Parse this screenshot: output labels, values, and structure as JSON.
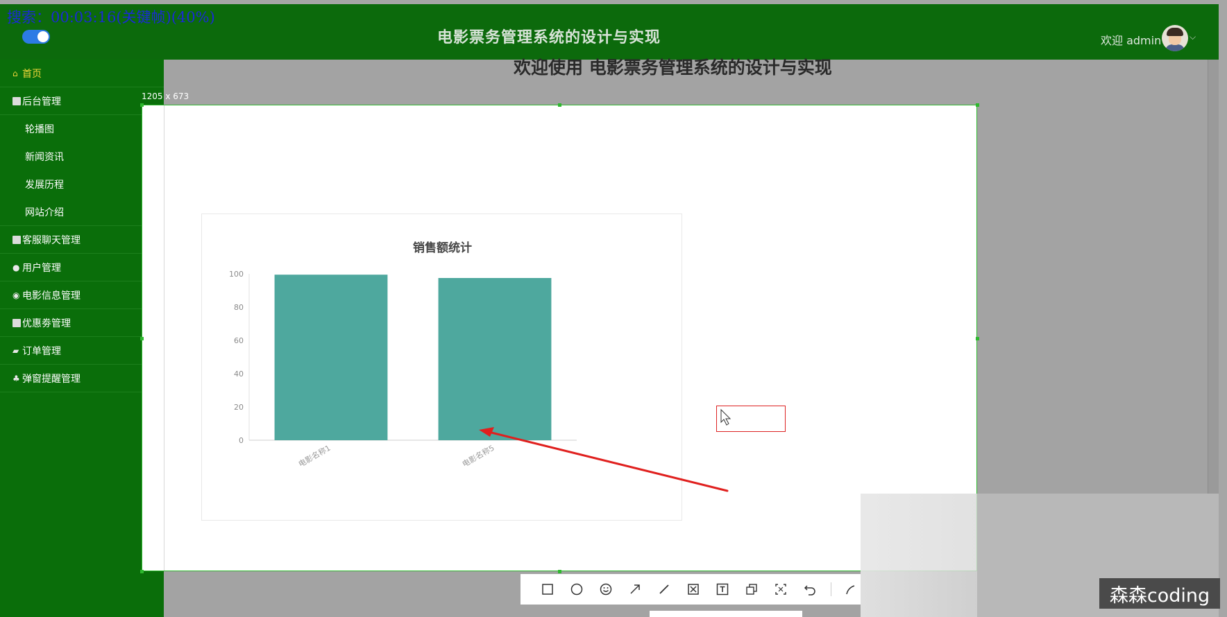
{
  "recorder_overlay": "搜索：00:03:16(关键帧)(40%)",
  "header": {
    "title": "电影票务管理系统的设计与实现",
    "welcome": "欢迎 admin"
  },
  "sidebar": {
    "items": [
      {
        "label": "首页",
        "icon": "home-icon",
        "active": true,
        "has_chevron": false,
        "sub": false
      },
      {
        "label": "后台管理",
        "icon": "grid-icon",
        "has_chevron": false,
        "sub": false
      },
      {
        "label": "轮播图",
        "sub": true
      },
      {
        "label": "新闻资讯",
        "sub": true
      },
      {
        "label": "发展历程",
        "sub": true
      },
      {
        "label": "网站介绍",
        "sub": true
      },
      {
        "label": "客服聊天管理",
        "icon": "grid-icon",
        "has_chevron": true,
        "sub": false
      },
      {
        "label": "用户管理",
        "icon": "user-icon",
        "has_chevron": true,
        "sub": false
      },
      {
        "label": "电影信息管理",
        "icon": "film-icon",
        "has_chevron": true,
        "sub": false
      },
      {
        "label": "优惠劵管理",
        "icon": "grid-icon",
        "has_chevron": true,
        "sub": false
      },
      {
        "label": "订单管理",
        "icon": "order-icon",
        "has_chevron": true,
        "sub": false
      },
      {
        "label": "弹窗提醒管理",
        "icon": "bell-icon",
        "has_chevron": true,
        "sub": false
      }
    ]
  },
  "main": {
    "heading": "欢迎使用 电影票务管理系统的设计与实现"
  },
  "capture": {
    "dimensions": "1205 x 673"
  },
  "chart_data": {
    "type": "bar",
    "title": "销售额统计",
    "categories": [
      "电影名称1",
      "电影名称5"
    ],
    "values": [
      99.5,
      97.5
    ],
    "ylim": [
      0,
      100
    ],
    "yticks": [
      "0",
      "20",
      "40",
      "60",
      "80",
      "100"
    ],
    "bar_color": "#4ea89e",
    "xlabel": "",
    "ylabel": ""
  },
  "toolbar": {
    "tools": [
      "rectangle-icon",
      "circle-icon",
      "emoji-icon",
      "arrow-icon",
      "line-icon",
      "mosaic-icon",
      "text-icon",
      "pin-icon",
      "ocr-icon",
      "undo-icon",
      "pen-icon"
    ]
  },
  "watermark": "森森coding",
  "colors": {
    "sidebar": "#0a6e0a",
    "header": "#0c6a0c",
    "active_menu": "#f2d73a",
    "selection_border": "#2eb82e",
    "annotation": "#d22222"
  }
}
